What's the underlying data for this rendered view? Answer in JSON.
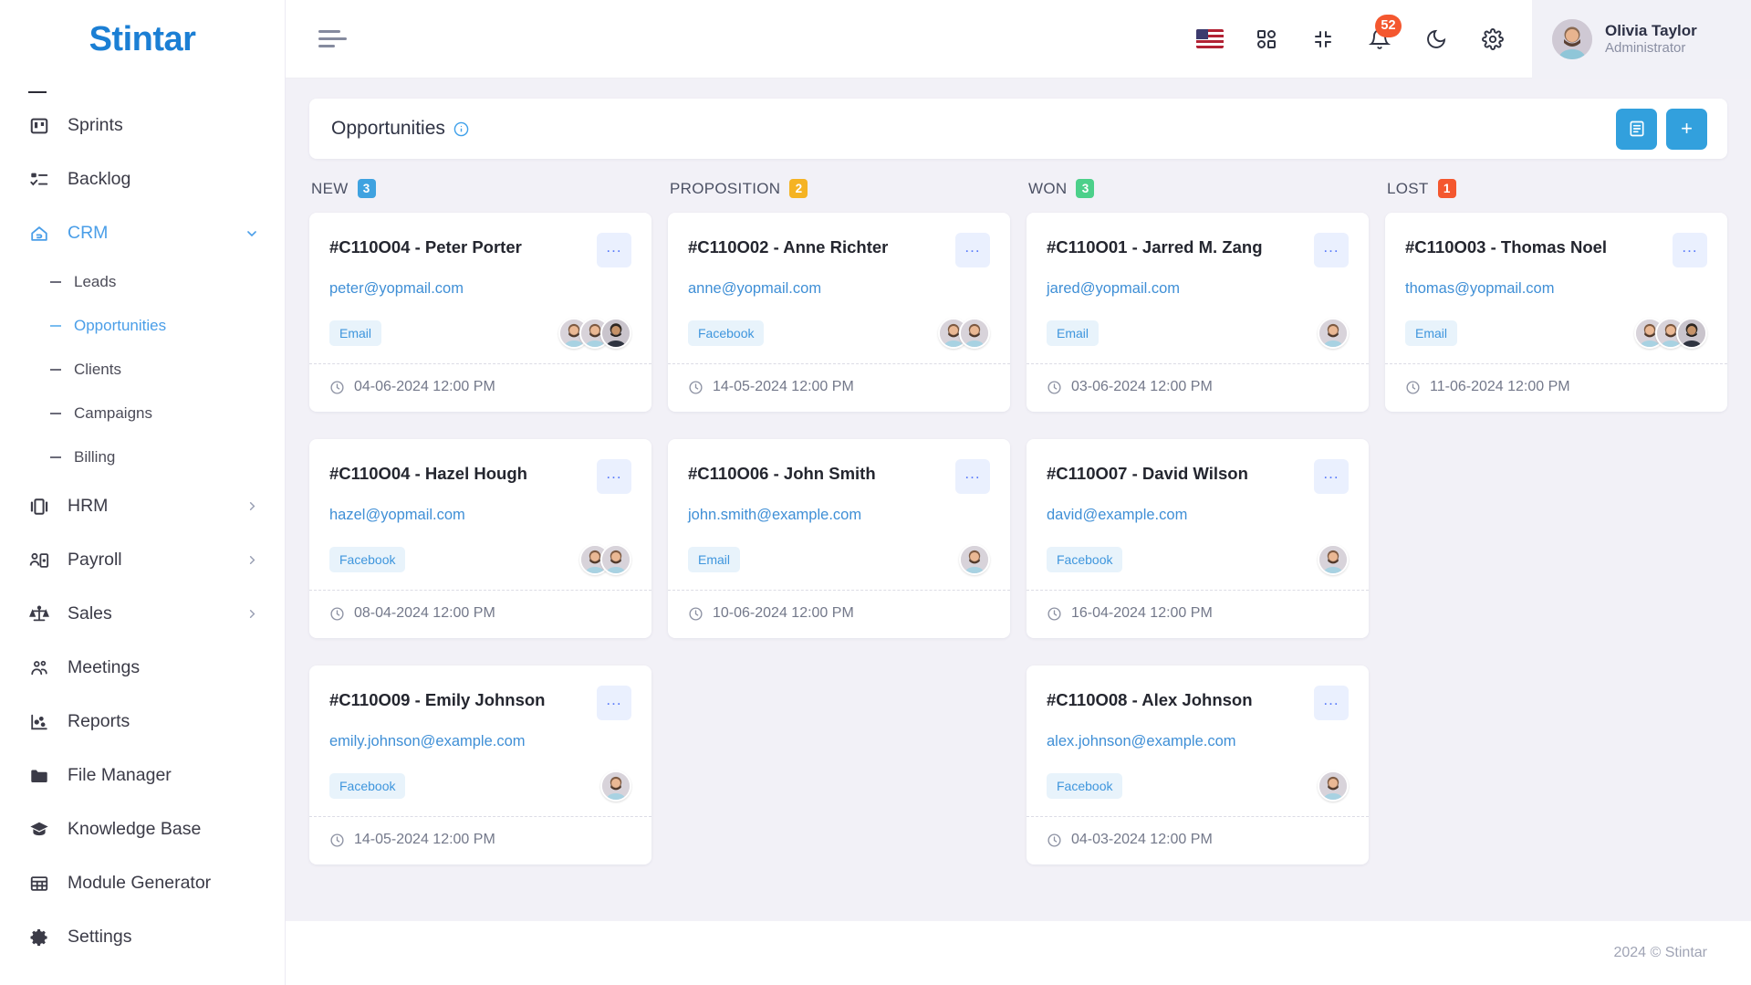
{
  "brand": {
    "name": "Stintar"
  },
  "sidebar": {
    "items": [
      {
        "label": "Sprints",
        "icon": "board-icon",
        "type": "item",
        "active": false,
        "chevron": ""
      },
      {
        "label": "Backlog",
        "icon": "checklist-icon",
        "type": "item",
        "active": false,
        "chevron": ""
      },
      {
        "label": "CRM",
        "icon": "crm-icon",
        "type": "item",
        "active": true,
        "chevron": "down"
      },
      {
        "label": "Leads",
        "type": "sub",
        "active": false
      },
      {
        "label": "Opportunities",
        "type": "sub",
        "active": true
      },
      {
        "label": "Clients",
        "type": "sub",
        "active": false
      },
      {
        "label": "Campaigns",
        "type": "sub",
        "active": false
      },
      {
        "label": "Billing",
        "type": "sub",
        "active": false
      },
      {
        "label": "HRM",
        "icon": "hrm-icon",
        "type": "item",
        "active": false,
        "chevron": "right"
      },
      {
        "label": "Payroll",
        "icon": "payroll-icon",
        "type": "item",
        "active": false,
        "chevron": "right"
      },
      {
        "label": "Sales",
        "icon": "scales-icon",
        "type": "item",
        "active": false,
        "chevron": "right"
      },
      {
        "label": "Meetings",
        "icon": "people-icon",
        "type": "item",
        "active": false,
        "chevron": ""
      },
      {
        "label": "Reports",
        "icon": "reports-icon",
        "type": "item",
        "active": false,
        "chevron": ""
      },
      {
        "label": "File Manager",
        "icon": "folder-icon",
        "type": "item",
        "active": false,
        "chevron": ""
      },
      {
        "label": "Knowledge Base",
        "icon": "graduation-icon",
        "type": "item",
        "active": false,
        "chevron": ""
      },
      {
        "label": "Module Generator",
        "icon": "grid-table-icon",
        "type": "item",
        "active": false,
        "chevron": ""
      },
      {
        "label": "Settings",
        "icon": "gear-icon",
        "type": "item",
        "active": false,
        "chevron": ""
      }
    ]
  },
  "topbar": {
    "menu_icon": "hamburger-icon",
    "icons": [
      {
        "name": "language-flag-us"
      },
      {
        "name": "apps-grid-icon"
      },
      {
        "name": "compress-icon"
      },
      {
        "name": "notification-bell-icon",
        "badge": "52"
      },
      {
        "name": "dark-mode-moon-icon"
      },
      {
        "name": "settings-gear-icon"
      }
    ],
    "notification_count": "52",
    "user": {
      "name": "Olivia Taylor",
      "role": "Administrator",
      "avatar": "user-avatar"
    }
  },
  "panel": {
    "title": "Opportunities",
    "info_icon": "info-circle-icon",
    "actions": [
      {
        "name": "list-view-button",
        "icon": "document-list-icon",
        "label": ""
      },
      {
        "name": "add-opportunity-button",
        "icon": "plus-icon",
        "label": "+"
      }
    ]
  },
  "board": {
    "columns": [
      {
        "title": "NEW",
        "count": "3",
        "color": "#3fa2e0",
        "cards": [
          {
            "title": "#C110O04 - Peter Porter",
            "email": "peter@yopmail.com",
            "tag": "Email",
            "avatars": 3,
            "date": "04-06-2024 12:00 PM",
            "menu": "..."
          },
          {
            "title": "#C110O04 - Hazel Hough",
            "email": "hazel@yopmail.com",
            "tag": "Facebook",
            "avatars": 2,
            "date": "08-04-2024 12:00 PM",
            "menu": "..."
          },
          {
            "title": "#C110O09 - Emily Johnson",
            "email": "emily.johnson@example.com",
            "tag": "Facebook",
            "avatars": 1,
            "date": "14-05-2024 12:00 PM",
            "menu": "..."
          }
        ]
      },
      {
        "title": "PROPOSITION",
        "count": "2",
        "color": "#f5b323",
        "cards": [
          {
            "title": "#C110O02 - Anne Richter",
            "email": "anne@yopmail.com",
            "tag": "Facebook",
            "avatars": 2,
            "date": "14-05-2024 12:00 PM",
            "menu": "..."
          },
          {
            "title": "#C110O06 - John Smith",
            "email": "john.smith@example.com",
            "tag": "Email",
            "avatars": 1,
            "date": "10-06-2024 12:00 PM",
            "menu": "..."
          }
        ]
      },
      {
        "title": "WON",
        "count": "3",
        "color": "#4cd08a",
        "cards": [
          {
            "title": "#C110O01 - Jarred M. Zang",
            "email": "jared@yopmail.com",
            "tag": "Email",
            "avatars": 1,
            "date": "03-06-2024 12:00 PM",
            "menu": "..."
          },
          {
            "title": "#C110O07 - David Wilson",
            "email": "david@example.com",
            "tag": "Facebook",
            "avatars": 1,
            "date": "16-04-2024 12:00 PM",
            "menu": "..."
          },
          {
            "title": "#C110O08 - Alex Johnson",
            "email": "alex.johnson@example.com",
            "tag": "Facebook",
            "avatars": 1,
            "date": "04-03-2024 12:00 PM",
            "menu": "..."
          }
        ]
      },
      {
        "title": "LOST",
        "count": "1",
        "color": "#f4572f",
        "cards": [
          {
            "title": "#C110O03 - Thomas Noel",
            "email": "thomas@yopmail.com",
            "tag": "Email",
            "avatars": 3,
            "date": "11-06-2024 12:00 PM",
            "menu": "..."
          }
        ]
      }
    ]
  },
  "footer": {
    "copyright": "2024 © Stintar"
  },
  "colors": {
    "accent": "#32a0dd",
    "link": "#3f8fd6",
    "danger": "#f4572f",
    "success": "#4cd08a",
    "warning": "#f5b323",
    "page_bg": "#f2f1f7"
  }
}
